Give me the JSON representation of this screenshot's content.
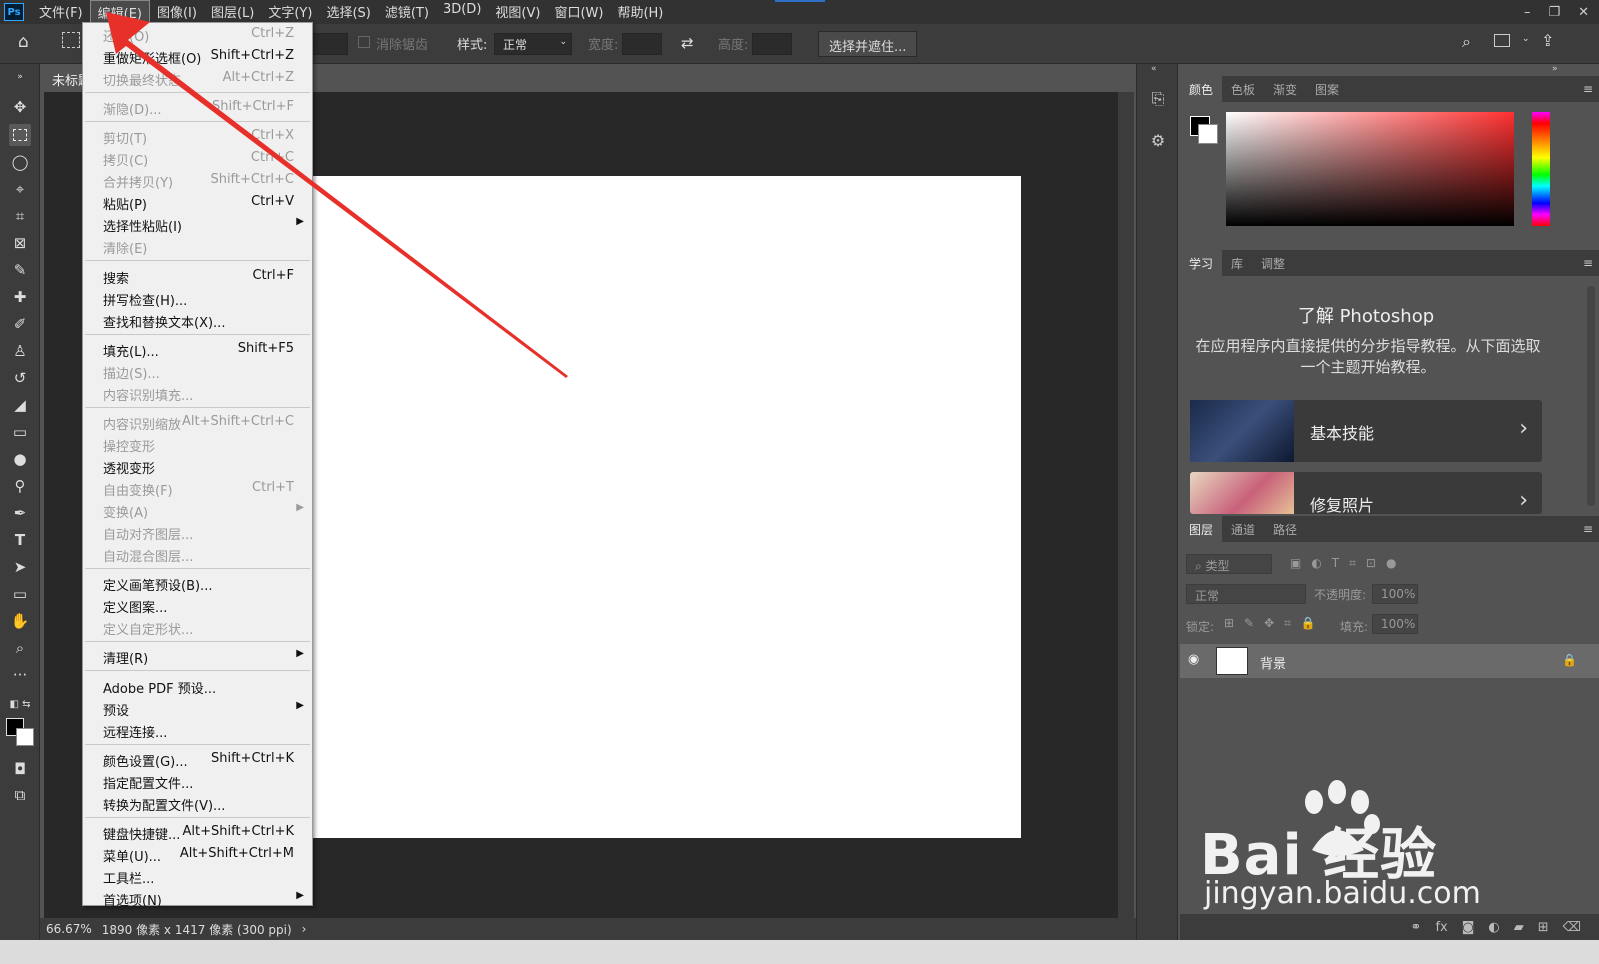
{
  "menubar": {
    "logo": "Ps",
    "items": [
      "文件(F)",
      "编辑(E)",
      "图像(I)",
      "图层(L)",
      "文字(Y)",
      "选择(S)",
      "滤镜(T)",
      "3D(D)",
      "视图(V)",
      "窗口(W)",
      "帮助(H)"
    ],
    "active_index": 1,
    "window_controls": [
      "–",
      "❐",
      "✕"
    ]
  },
  "optionsbar": {
    "antialias_label": "消除锯齿",
    "style_label": "样式:",
    "style_value": "正常",
    "width_label": "宽度:",
    "height_label": "高度:",
    "select_mask_button": "选择并遮住..."
  },
  "document": {
    "tab_label": "未标题",
    "zoom": "66.67%",
    "info": "1890 像素 x 1417 像素 (300 ppi)"
  },
  "edit_menu": {
    "items": [
      {
        "label": "还原(O)",
        "shortcut": "Ctrl+Z",
        "disabled": true
      },
      {
        "label": "重做矩形选框(O)",
        "shortcut": "Shift+Ctrl+Z",
        "disabled": false
      },
      {
        "label": "切换最终状态",
        "shortcut": "Alt+Ctrl+Z",
        "disabled": true
      },
      {
        "label": "渐隐(D)...",
        "shortcut": "Shift+Ctrl+F",
        "disabled": true
      },
      {
        "label": "剪切(T)",
        "shortcut": "Ctrl+X",
        "disabled": true
      },
      {
        "label": "拷贝(C)",
        "shortcut": "Ctrl+C",
        "disabled": true
      },
      {
        "label": "合并拷贝(Y)",
        "shortcut": "Shift+Ctrl+C",
        "disabled": true
      },
      {
        "label": "粘贴(P)",
        "shortcut": "Ctrl+V",
        "disabled": false
      },
      {
        "label": "选择性粘贴(I)",
        "shortcut": "",
        "disabled": false,
        "submenu": true
      },
      {
        "label": "清除(E)",
        "shortcut": "",
        "disabled": true
      },
      {
        "label": "搜索",
        "shortcut": "Ctrl+F",
        "disabled": false
      },
      {
        "label": "拼写检查(H)...",
        "shortcut": "",
        "disabled": false
      },
      {
        "label": "查找和替换文本(X)...",
        "shortcut": "",
        "disabled": false
      },
      {
        "label": "填充(L)...",
        "shortcut": "Shift+F5",
        "disabled": false
      },
      {
        "label": "描边(S)...",
        "shortcut": "",
        "disabled": true
      },
      {
        "label": "内容识别填充...",
        "shortcut": "",
        "disabled": true
      },
      {
        "label": "内容识别缩放",
        "shortcut": "Alt+Shift+Ctrl+C",
        "disabled": true
      },
      {
        "label": "操控变形",
        "shortcut": "",
        "disabled": true
      },
      {
        "label": "透视变形",
        "shortcut": "",
        "disabled": false
      },
      {
        "label": "自由变换(F)",
        "shortcut": "Ctrl+T",
        "disabled": true
      },
      {
        "label": "变换(A)",
        "shortcut": "",
        "disabled": true,
        "submenu": true
      },
      {
        "label": "自动对齐图层...",
        "shortcut": "",
        "disabled": true
      },
      {
        "label": "自动混合图层...",
        "shortcut": "",
        "disabled": true
      },
      {
        "label": "定义画笔预设(B)...",
        "shortcut": "",
        "disabled": false
      },
      {
        "label": "定义图案...",
        "shortcut": "",
        "disabled": false
      },
      {
        "label": "定义自定形状...",
        "shortcut": "",
        "disabled": true
      },
      {
        "label": "清理(R)",
        "shortcut": "",
        "disabled": false,
        "submenu": true
      },
      {
        "label": "Adobe PDF 预设...",
        "shortcut": "",
        "disabled": false
      },
      {
        "label": "预设",
        "shortcut": "",
        "disabled": false,
        "submenu": true
      },
      {
        "label": "远程连接...",
        "shortcut": "",
        "disabled": false
      },
      {
        "label": "颜色设置(G)...",
        "shortcut": "Shift+Ctrl+K",
        "disabled": false
      },
      {
        "label": "指定配置文件...",
        "shortcut": "",
        "disabled": false
      },
      {
        "label": "转换为配置文件(V)...",
        "shortcut": "",
        "disabled": false
      },
      {
        "label": "键盘快捷键...",
        "shortcut": "Alt+Shift+Ctrl+K",
        "disabled": false
      },
      {
        "label": "菜单(U)...",
        "shortcut": "Alt+Shift+Ctrl+M",
        "disabled": false
      },
      {
        "label": "工具栏...",
        "shortcut": "",
        "disabled": false
      },
      {
        "label": "首选项(N)",
        "shortcut": "",
        "disabled": false,
        "submenu": true
      }
    ]
  },
  "color_panel": {
    "tabs": [
      "颜色",
      "色板",
      "渐变",
      "图案"
    ]
  },
  "learn_panel": {
    "tabs": [
      "学习",
      "库",
      "调整"
    ],
    "title": "了解 Photoshop",
    "description": "在应用程序内直接提供的分步指导教程。从下面选取一个主题开始教程。",
    "cards": [
      "基本技能",
      "修复照片"
    ]
  },
  "layers_panel": {
    "tabs": [
      "图层",
      "通道",
      "路径"
    ],
    "filter_placeholder": "类型",
    "blend_mode": "正常",
    "opacity_label": "不透明度:",
    "opacity_value": "100%",
    "lock_label": "锁定:",
    "fill_label": "填充:",
    "fill_value": "100%",
    "layer_name": "背景"
  },
  "watermark": {
    "brand": "Bai  经验",
    "url": "jingyan.baidu.com"
  },
  "colors": {
    "annotation_arrow": "#e8302a",
    "menu_bg": "#f0f0f0",
    "panel_dark": "#3c3c3c"
  }
}
